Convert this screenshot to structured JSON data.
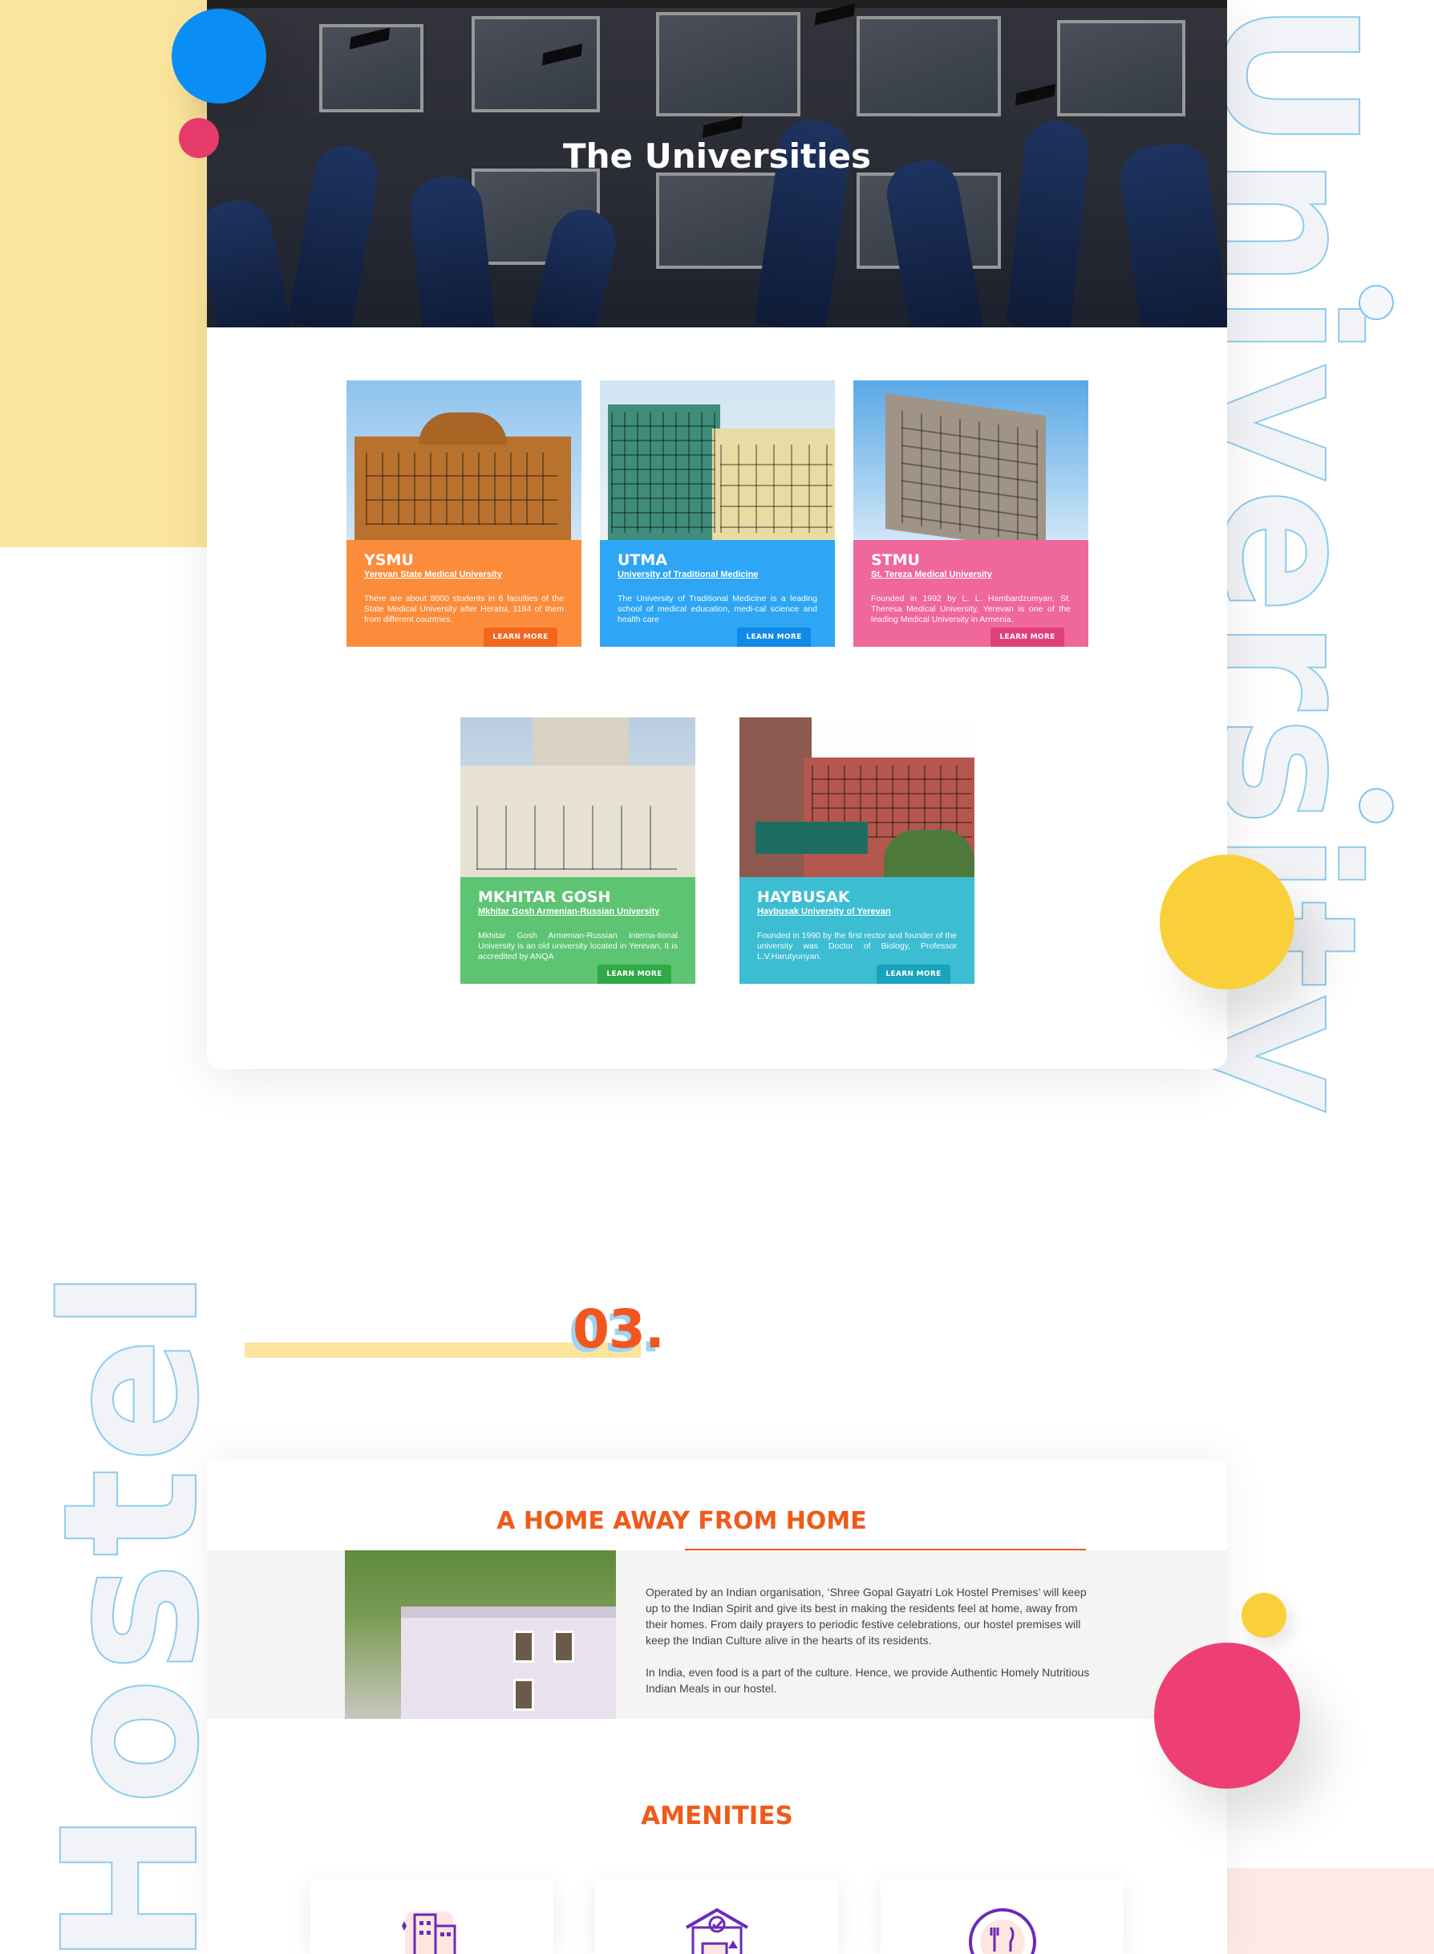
{
  "hero": {
    "title": "The Universities"
  },
  "universities": [
    {
      "abbr": "YSMU",
      "name": "Yerevan State Medical University",
      "description": "There are about 8000 students in 6 faculties of the State Medical University after Heratsi, 1184 of them from different countries.",
      "button": "LEARN MORE",
      "color": "#fb8c3c"
    },
    {
      "abbr": "UTMA",
      "name": "University of Traditional Medicine",
      "description": "The University of Traditional Medicine is a leading school of medical education, medi-cal science and health care",
      "button": "LEARN MORE",
      "color": "#2ea6f5"
    },
    {
      "abbr": "STMU",
      "name": "St. Tereza Medical University",
      "description": "Founded in 1992 by L. L. Hambardzumyan, St. Theresa Medical University, Yerevan is one of the leading Medical University in Armenia.",
      "button": "LEARN MORE",
      "color": "#f0679a"
    },
    {
      "abbr": "MKHITAR GOSH",
      "name": "Mkhitar Gosh Armenian-Russian University",
      "description": "Mkhitar Gosh Armenian-Russian Interna-tional University is an old university located in Yerevan, It is accredited by ANQA",
      "button": "LEARN MORE",
      "color": "#5cc472"
    },
    {
      "abbr": "HAYBUSAK",
      "name": "Haybusak University of Yerevan",
      "description": "Founded in 1990 by the first rector and founder of the university was Doctor of Biology, Professor L.V.Harutyunyan.",
      "button": "LEARN MORE",
      "color": "#3dbdd2"
    }
  ],
  "decor": {
    "word_right": "University",
    "word_left": "Hostel"
  },
  "section": {
    "number": "03.",
    "title": "A HOME AWAY FROM HOME",
    "paragraphs": [
      "Operated by an Indian organisation, ‘Shree Gopal Gayatri Lok Hostel Premises’ will keep up to the Indian Spirit and give its best in making the residents feel at home, away from their homes. From daily prayers to periodic festive celebrations, our hostel premises will keep the Indian Culture alive in the hearts of its residents.",
      "In India, even food is a part of the culture. Hence, we provide Authentic Homely Nutritious Indian Meals in our hostel."
    ],
    "amenities_title": "AMENITIES",
    "amenities_icons": [
      "building-icon",
      "secure-room-icon",
      "food-plate-icon"
    ]
  },
  "colors": {
    "accent": "#ef5a1a",
    "blue": "#0a8ef5",
    "yellow": "#f9d03a",
    "pink": "#ed3f73"
  }
}
